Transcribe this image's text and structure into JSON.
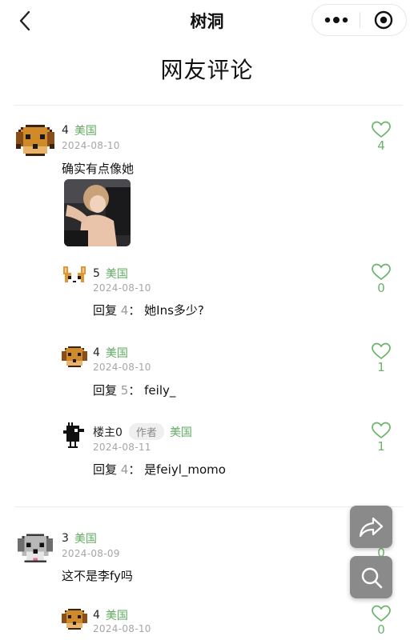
{
  "header": {
    "title": "树洞",
    "back_icon": "chevron-left-icon",
    "more_icon": "more-dots-icon",
    "close_icon": "target-close-icon"
  },
  "page": {
    "heading": "网友评论"
  },
  "comments": [
    {
      "author": "4",
      "location": "美国",
      "date": "2024-08-10",
      "text": "确实有点像她",
      "likes": "4",
      "has_photo": true,
      "replies": [
        {
          "author": "5",
          "location": "美国",
          "date": "2024-08-10",
          "reply_prefix": "回复",
          "reply_to": "4",
          "reply_sep": "：",
          "text": "她Ins多少?",
          "likes": "0"
        },
        {
          "author": "4",
          "location": "美国",
          "date": "2024-08-10",
          "reply_prefix": "回复",
          "reply_to": "5",
          "reply_sep": "：",
          "text": "feily_",
          "likes": "1"
        },
        {
          "author": "楼主0",
          "badge": "作者",
          "location": "美国",
          "date": "2024-08-11",
          "reply_prefix": "回复",
          "reply_to": "4",
          "reply_sep": "：",
          "text": "是feiyl_momo",
          "likes": "1"
        }
      ]
    },
    {
      "author": "3",
      "location": "美国",
      "date": "2024-08-09",
      "text": "这不是李fy吗",
      "likes": "0",
      "replies": [
        {
          "author": "4",
          "location": "美国",
          "date": "2024-08-10",
          "likes": "0"
        }
      ]
    }
  ],
  "fab": {
    "share_icon": "share-icon",
    "search_icon": "search-icon"
  },
  "colors": {
    "accent_green": "#5fae5f",
    "date_gray": "#a6a6a6",
    "fab_gray": "#8a8a8a"
  }
}
